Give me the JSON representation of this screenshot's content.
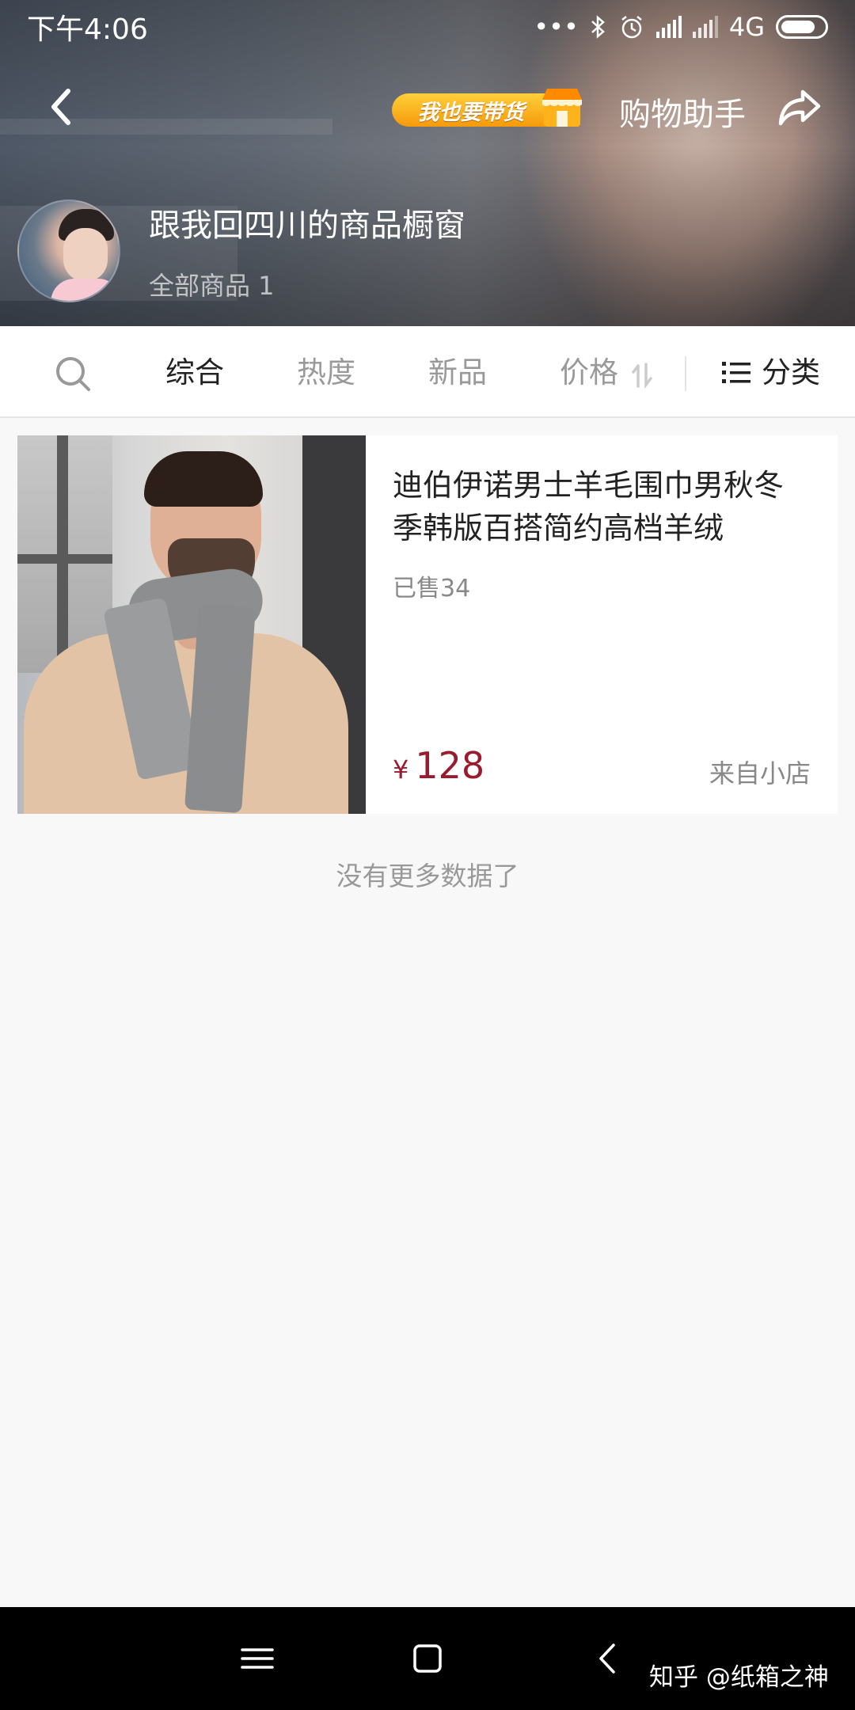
{
  "status_bar": {
    "time": "下午4:06",
    "network": "4G"
  },
  "header": {
    "promo_badge_text": "我也要带货",
    "assistant_label": "购物助手",
    "store_title": "跟我回四川的商品橱窗",
    "store_count": "全部商品 1",
    "icons": [
      "back-icon",
      "shop-icon",
      "share-icon"
    ]
  },
  "filters": {
    "tabs": [
      "综合",
      "热度",
      "新品",
      "价格"
    ],
    "active_tab": "综合",
    "category_label": "分类",
    "icons": [
      "search-icon",
      "sort-icon",
      "list-icon"
    ]
  },
  "products": [
    {
      "title": "迪伯伊诺男士羊毛围巾男秋冬季韩版百搭简约高档羊绒",
      "sold": "已售34",
      "currency": "¥",
      "price": "128",
      "source": "来自小店"
    }
  ],
  "footer_text": "没有更多数据了",
  "system_nav": {
    "icons": [
      "menu-icon",
      "home-icon",
      "back-nav-icon"
    ]
  },
  "watermark": "知乎 @纸箱之神",
  "colors": {
    "price": "#9a1b2e",
    "promo": "#f59a0b",
    "background": "#f8f8f8"
  }
}
